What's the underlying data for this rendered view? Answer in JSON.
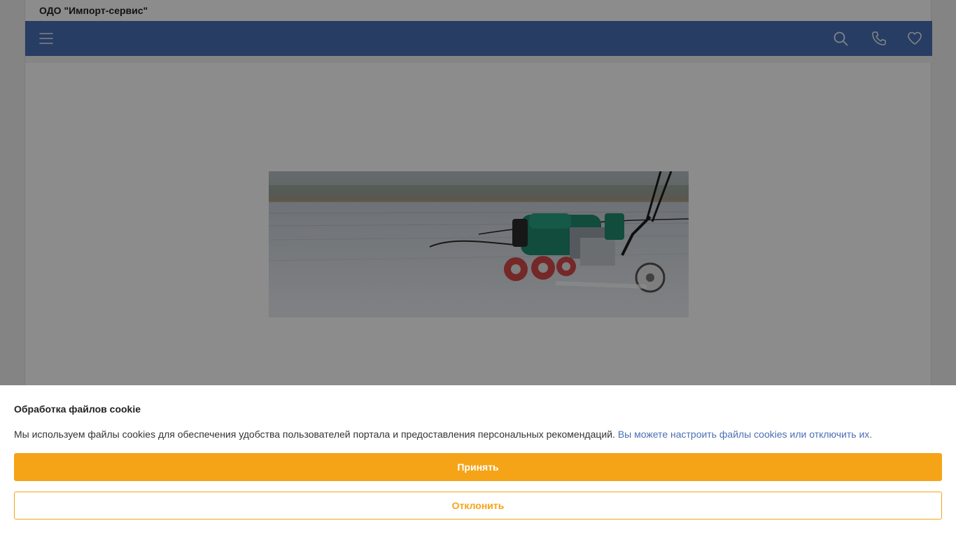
{
  "header": {
    "company_name": "ОДО \"Импорт-сервис\""
  },
  "navbar": {
    "background_color": "#4a6fb5",
    "icons": [
      "menu-icon",
      "search-icon",
      "phone-icon",
      "heart-icon"
    ]
  },
  "banner": {
    "image": "roof-welding-machine-photo"
  },
  "cookie_banner": {
    "title": "Обработка файлов cookie",
    "text": "Мы используем файлы cookies для обеспечения удобства пользователей портала и предоставления персональных рекомендаций.",
    "link_text": "Вы можете настроить файлы cookies или отключить их.",
    "accept_label": "Принять",
    "decline_label": "Отклонить",
    "accent_color": "#f5a417",
    "link_color": "#4a6fb5"
  }
}
